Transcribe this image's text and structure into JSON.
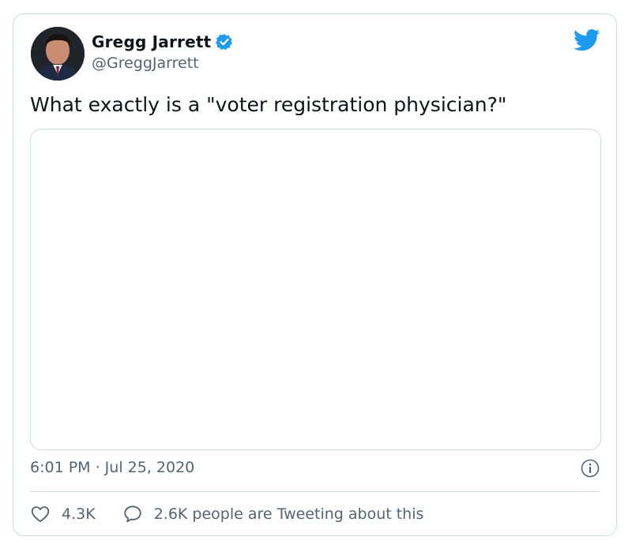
{
  "tweet": {
    "author_name": "Gregg Jarrett",
    "author_handle": "@GreggJarrett",
    "text": "What exactly is a \"voter registration physician?\"",
    "timestamp": "6:01 PM · Jul 25, 2020",
    "likes": "4.3K",
    "discussion": "2.6K people are Tweeting about this"
  },
  "icons": {
    "verified": "verified-badge-icon",
    "brand": "twitter-bird-icon",
    "info": "info-icon",
    "like": "heart-icon",
    "reply": "speech-bubble-icon"
  },
  "colors": {
    "brand_blue": "#1d9bf0",
    "text": "#0f1419",
    "muted": "#536471",
    "border": "#cfd9de"
  }
}
